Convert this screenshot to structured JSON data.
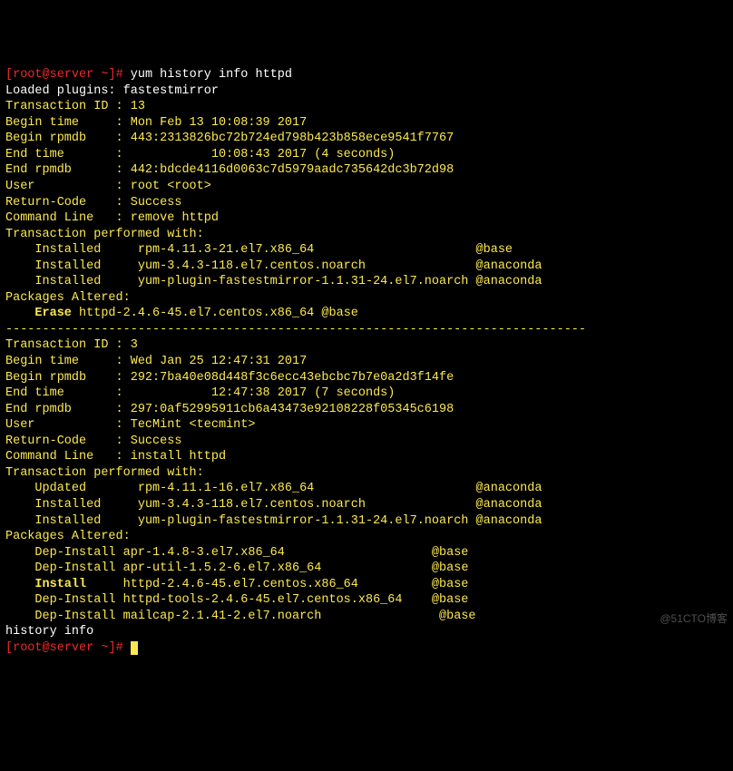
{
  "prompt1": {
    "user": "root@server",
    "path": "~",
    "symbol": "#",
    "command": "yum history info httpd"
  },
  "loaded_plugins": "Loaded plugins: fastestmirror",
  "tx1": {
    "id_label": "Transaction ID :",
    "id_value": "13",
    "begin_time_label": "Begin time     :",
    "begin_time_value": "Mon Feb 13 10:08:39 2017",
    "begin_rpmdb_label": "Begin rpmdb    :",
    "begin_rpmdb_value": "443:2313826bc72b724ed798b423b858ece9541f7767",
    "end_time_label": "End time       :",
    "end_time_value": "           10:08:43 2017 (4 seconds)",
    "end_rpmdb_label": "End rpmdb      :",
    "end_rpmdb_value": "442:bdcde4116d0063c7d5979aadc735642dc3b72d98",
    "user_label": "User           :",
    "user_value": "root <root>",
    "return_code_label": "Return-Code    :",
    "return_code_value": "Success",
    "command_line_label": "Command Line   :",
    "command_line_value": "remove httpd",
    "performed_with_label": "Transaction performed with:",
    "performed_with": [
      {
        "action": "Installed",
        "pkg": "rpm-4.11.3-21.el7.x86_64",
        "repo": "@base"
      },
      {
        "action": "Installed",
        "pkg": "yum-3.4.3-118.el7.centos.noarch",
        "repo": "@anaconda"
      },
      {
        "action": "Installed",
        "pkg": "yum-plugin-fastestmirror-1.1.31-24.el7.noarch",
        "repo": "@anaconda"
      }
    ],
    "altered_label": "Packages Altered:",
    "altered": [
      {
        "action": "Erase",
        "pkg": "httpd-2.4.6-45.el7.centos.x86_64",
        "repo": "@base",
        "bold": true
      }
    ]
  },
  "separator": "-------------------------------------------------------------------------------",
  "tx2": {
    "id_label": "Transaction ID :",
    "id_value": "3",
    "begin_time_label": "Begin time     :",
    "begin_time_value": "Wed Jan 25 12:47:31 2017",
    "begin_rpmdb_label": "Begin rpmdb    :",
    "begin_rpmdb_value": "292:7ba40e08d448f3c6ecc43ebcbc7b7e0a2d3f14fe",
    "end_time_label": "End time       :",
    "end_time_value": "           12:47:38 2017 (7 seconds)",
    "end_rpmdb_label": "End rpmdb      :",
    "end_rpmdb_value": "297:0af52995911cb6a43473e92108228f05345c6198",
    "user_label": "User           :",
    "user_value": "TecMint <tecmint>",
    "return_code_label": "Return-Code    :",
    "return_code_value": "Success",
    "command_line_label": "Command Line   :",
    "command_line_value": "install httpd",
    "performed_with_label": "Transaction performed with:",
    "performed_with": [
      {
        "action": "Updated",
        "pkg": "rpm-4.11.1-16.el7.x86_64",
        "repo": "@anaconda"
      },
      {
        "action": "Installed",
        "pkg": "yum-3.4.3-118.el7.centos.noarch",
        "repo": "@anaconda"
      },
      {
        "action": "Installed",
        "pkg": "yum-plugin-fastestmirror-1.1.31-24.el7.noarch",
        "repo": "@anaconda"
      }
    ],
    "altered_label": "Packages Altered:",
    "altered": [
      {
        "action": "Dep-Install",
        "pkg": "apr-1.4.8-3.el7.x86_64",
        "repo": "@base",
        "bold": false
      },
      {
        "action": "Dep-Install",
        "pkg": "apr-util-1.5.2-6.el7.x86_64",
        "repo": "@base",
        "bold": false
      },
      {
        "action": "Install",
        "pkg": "httpd-2.4.6-45.el7.centos.x86_64",
        "repo": "@base",
        "bold": true
      },
      {
        "action": "Dep-Install",
        "pkg": "httpd-tools-2.4.6-45.el7.centos.x86_64",
        "repo": "@base",
        "bold": false
      },
      {
        "action": "Dep-Install",
        "pkg": "mailcap-2.1.41-2.el7.noarch",
        "repo": "@base",
        "bold": false
      }
    ]
  },
  "history_info": "history info",
  "prompt2": {
    "user": "root@server",
    "path": "~",
    "symbol": "#"
  },
  "watermark": "@51CTO博客"
}
